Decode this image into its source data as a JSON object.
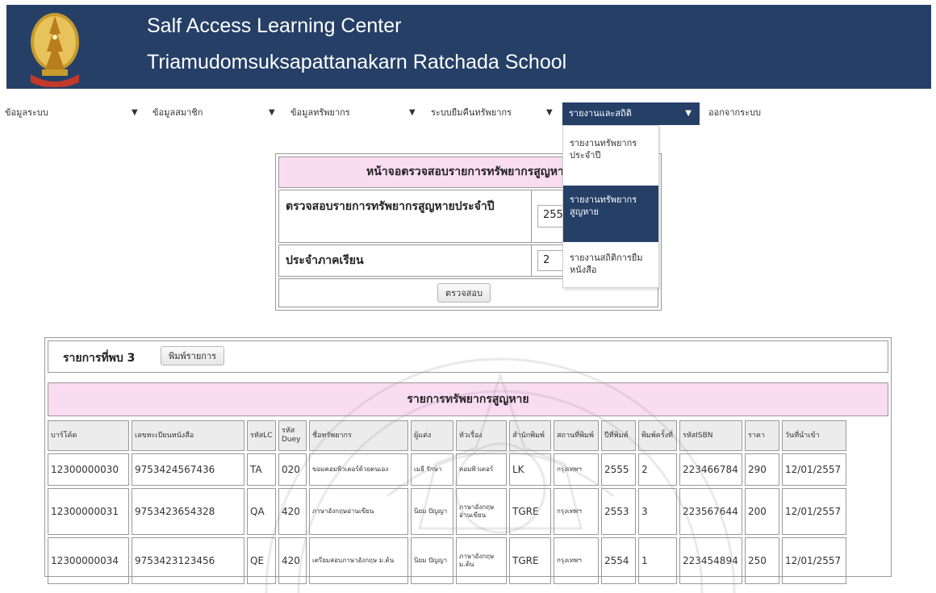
{
  "header": {
    "title_line1": "Salf Access Learning Center",
    "title_line2": "Triamudomsuksapattanakarn Ratchada  School",
    "logo_icon": "school-emblem-icon"
  },
  "menu": {
    "items": [
      {
        "label": "ข้อมูลระบบ"
      },
      {
        "label": "ข้อมูลสมาชิก"
      },
      {
        "label": "ข้อมูลทรัพยากร"
      },
      {
        "label": "ระบบยืมคืนทรัพยากร"
      },
      {
        "label": "รายงานและสถิติ"
      },
      {
        "label": "ออกจากระบบ"
      }
    ],
    "caret": "▼",
    "active_index": 4
  },
  "dropdown": {
    "items": [
      {
        "label": "รายงานทรัพยากรประจำปี"
      },
      {
        "label": "รายงานทรัพยากรสูญหาย"
      },
      {
        "label": "รายงานสถิติการยืมหนังสือ"
      }
    ],
    "active_index": 1
  },
  "form": {
    "heading": "หน้าจอตรวจสอบรายการทรัพยากรสูญหาย",
    "year_label": "ตรวจสอบรายการทรัพยากรสูญหายประจำปี",
    "year_value": "2556",
    "term_label": "ประจำภาคเรียน",
    "term_value": "2",
    "submit_label": "ตรวจสอบ"
  },
  "results": {
    "count_label": "รายการที่พบ 3",
    "print_label": "พิมพ์รายการ",
    "table_title": "รายการทรัพยากรสูญหาย",
    "columns": [
      "บาร์โค้ด",
      "เลขทะเบียนหนังสือ",
      "รหัสLC",
      "รหัส Duey",
      "ชื่อทรัพยากร",
      "ผู้แต่ง",
      "หัวเรื่อง",
      "สำนักพิมพ์",
      "สถานที่พิมพ์",
      "ปีที่พิมพ์",
      "พิมพ์ครั้งที่",
      "รหัสISBN",
      "ราคา",
      "วันที่นำเข้า"
    ],
    "rows": [
      [
        "12300000030",
        "9753424567436",
        "TA",
        "020",
        "ขอมคอมพิวเตอร์ด้วยตนเอง",
        "เมธี รักษา",
        "คอมพิวเตอร์",
        "LK",
        "กรุงเทพฯ",
        "2555",
        "2",
        "223466784",
        "290",
        "12/01/2557"
      ],
      [
        "12300000031",
        "9753423654328",
        "QA",
        "420",
        "ภาษาอังกฤษอ่านเขียน",
        "นิยม ปัญญา",
        "ภาษาอังกฤษ อ่านเขียน",
        "TGRE",
        "กรุงเทพฯ",
        "2553",
        "3",
        "223567644",
        "200",
        "12/01/2557"
      ],
      [
        "12300000034",
        "9753423123456",
        "QE",
        "420",
        "เตรียมสอบภาษาอังกฤษ ม.ต้น",
        "นิยม ปัญญา",
        "ภาษาอังกฤษ ม.ต้น",
        "TGRE",
        "กรุงเทพฯ",
        "2554",
        "1",
        "223454894",
        "250",
        "12/01/2557"
      ]
    ]
  }
}
